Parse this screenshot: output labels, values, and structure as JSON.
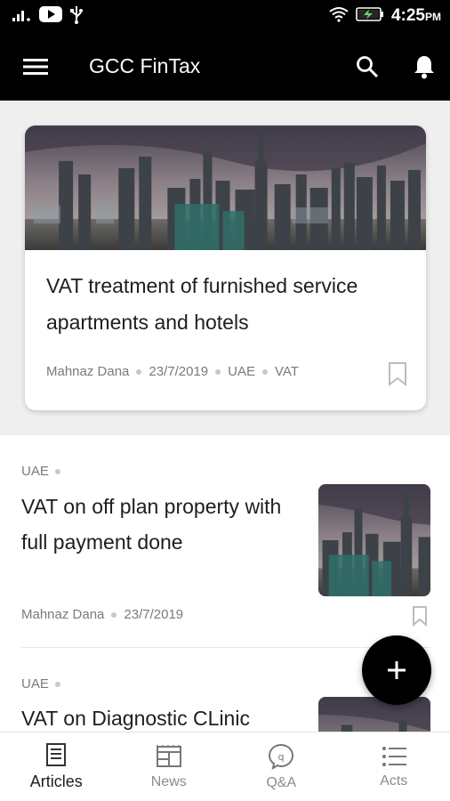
{
  "status_bar": {
    "time": "4:25",
    "ampm": "PM",
    "icons": [
      "signal-icon",
      "youtube-icon",
      "usb-icon",
      "wifi-icon",
      "battery-charging-icon"
    ]
  },
  "app_bar": {
    "title": "GCC FinTax",
    "icons": [
      "menu-icon",
      "search-icon",
      "bell-icon"
    ]
  },
  "featured": {
    "title": "VAT treatment of furnished service apartments and hotels",
    "author": "Mahnaz Dana",
    "date": "23/7/2019",
    "tags": [
      "UAE",
      "VAT"
    ]
  },
  "articles": [
    {
      "tag": "UAE",
      "title": "VAT on off plan property with full payment done",
      "author": "Mahnaz Dana",
      "date": "23/7/2019"
    },
    {
      "tag": "UAE",
      "title": "VAT on Diagnostic CLinic"
    }
  ],
  "bottom_nav": [
    {
      "label": "Articles",
      "icon": "articles-icon",
      "active": true
    },
    {
      "label": "News",
      "icon": "news-icon",
      "active": false
    },
    {
      "label": "Q&A",
      "icon": "qa-icon",
      "active": false
    },
    {
      "label": "Acts",
      "icon": "acts-list-icon",
      "active": false
    }
  ],
  "colors": {
    "app_bar_bg": "#000000",
    "featured_bg": "#efefef",
    "text_primary": "#1e1e1e",
    "text_secondary": "#7a7a7a",
    "fab_bg": "#000000"
  }
}
